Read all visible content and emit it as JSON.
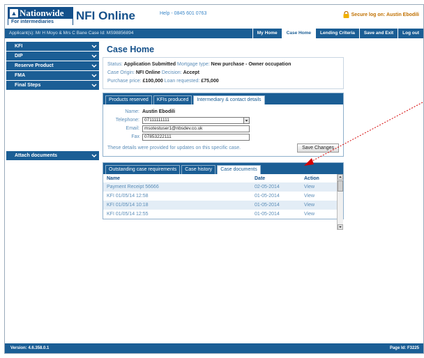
{
  "brand": {
    "logo_name": "Nationwide",
    "logo_sub": "For intermediaries",
    "product_title": "NFI Online",
    "help_text": "Help - 0845 601 0763",
    "secure_text": "Secure log on: Austin Ebodili"
  },
  "navbar": {
    "applicant_text": "Applicant(s): Mr H Moyo & Mrs C Bane  Case Id: MS98856894",
    "tabs": [
      {
        "label": "My Home"
      },
      {
        "label": "Case Home"
      },
      {
        "label": "Lending Criteria"
      },
      {
        "label": "Save and Exit"
      },
      {
        "label": "Log out"
      }
    ],
    "active_tab": "Case Home"
  },
  "sidebar": {
    "items": [
      {
        "label": "KFI"
      },
      {
        "label": "DIP"
      },
      {
        "label": "Reserve Product"
      },
      {
        "label": "FMA"
      },
      {
        "label": "Final Steps"
      }
    ],
    "attach_label": "Attach documents"
  },
  "case": {
    "title": "Case Home",
    "status_label": "Status:",
    "status_value": "Application Submitted",
    "mortgage_type_label": "Mortgage type:",
    "mortgage_type_value": "New purchase - Owner occupation",
    "origin_label": "Case Origin:",
    "origin_value": "NFI Online",
    "decision_label": "Decision:",
    "decision_value": "Accept",
    "price_label": "Purchase price:",
    "price_value": "£100,000",
    "loan_label": "Loan requested:",
    "loan_value": "£75,000"
  },
  "contact_panel": {
    "tabs": [
      {
        "label": "Products reserved"
      },
      {
        "label": "KFIs produced"
      },
      {
        "label": "Intermediary & contact details"
      }
    ],
    "active_tab": "Intermediary & contact details",
    "name_label": "Name:",
    "name_value": "Austin Ebodili",
    "telephone_label": "Telephone:",
    "telephone_value": "07111111111",
    "email_label": "Email:",
    "email_value": "msotestuser1@nbsdev.co.uk",
    "fax_label": "Fax",
    "fax_value": "07853222111",
    "note": "These details were provided for updates on this specific case.",
    "save_label": "Save Changes"
  },
  "docs_panel": {
    "tabs": [
      {
        "label": "Outstanding case requirements"
      },
      {
        "label": "Case history"
      },
      {
        "label": "Case documents"
      }
    ],
    "active_tab": "Case documents",
    "columns": {
      "name": "Name",
      "date": "Date",
      "action": "Action"
    },
    "rows": [
      {
        "name": "Payment Receipt 56666",
        "date": "02-05-2014",
        "action": "View"
      },
      {
        "name": "KFI 01/05/14 12:58",
        "date": "01-05-2014",
        "action": "View"
      },
      {
        "name": "KFI 01/05/14 10:18",
        "date": "01-05-2014",
        "action": "View"
      },
      {
        "name": "KFI 01/05/14 12:55",
        "date": "01-05-2014",
        "action": "View"
      }
    ]
  },
  "footer": {
    "version": "Version: 4.6.358.0.1",
    "page_id": "Page Id: F3225"
  },
  "colors": {
    "brand_blue": "#1b5e95",
    "title_blue": "#14508a",
    "label_blue": "#5b8db8",
    "row_stripe": "#e3edf6",
    "annotation_red": "#d40000"
  }
}
